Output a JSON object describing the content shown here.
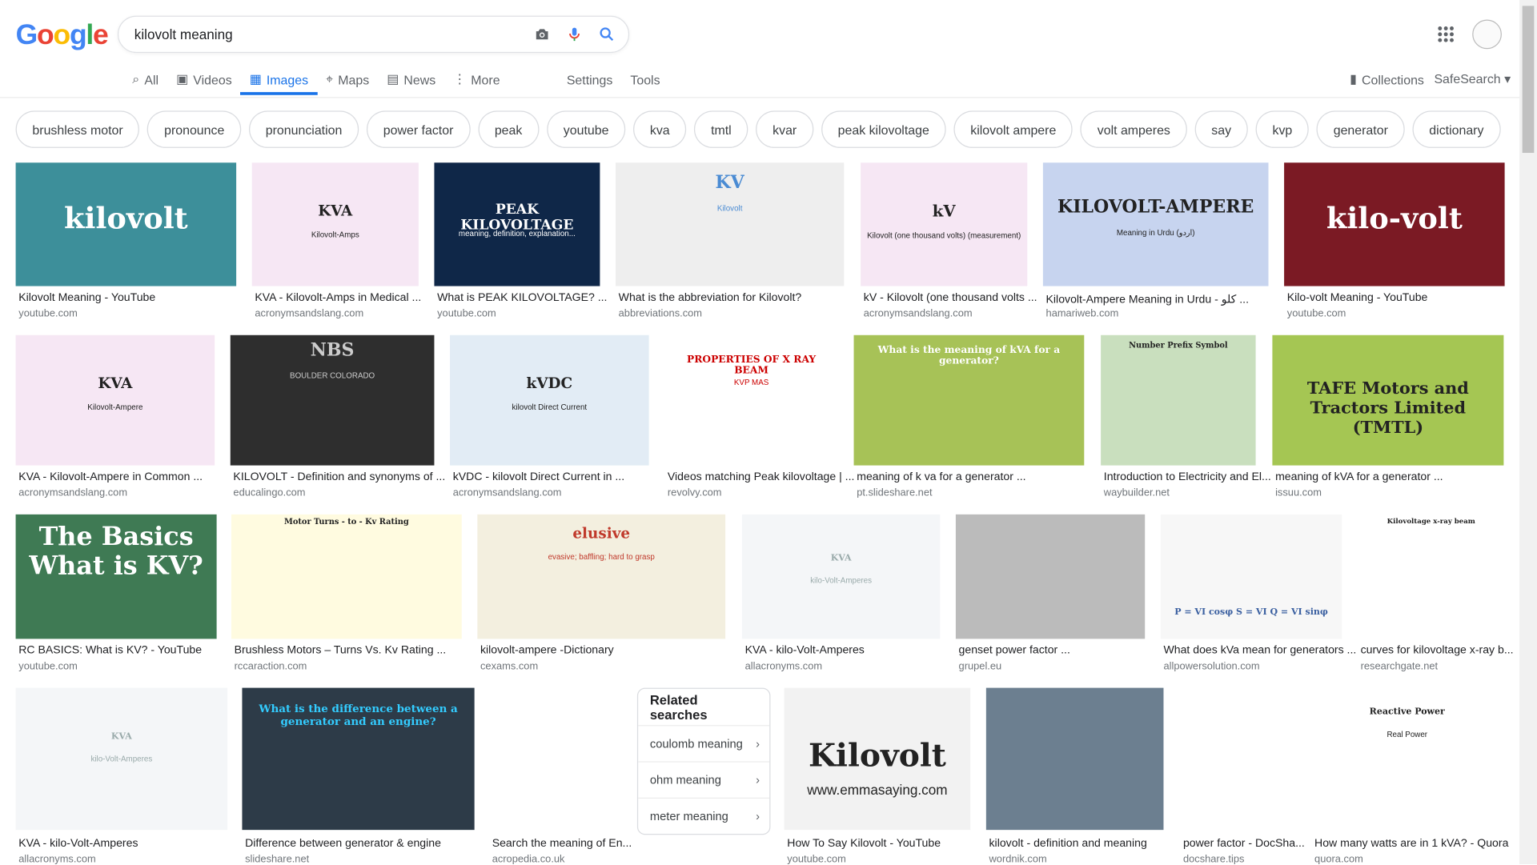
{
  "logo": "Google",
  "search": {
    "query": "kilovolt meaning"
  },
  "tabs": [
    {
      "label": "All",
      "icon": "search-icon"
    },
    {
      "label": "Videos",
      "icon": "video-icon"
    },
    {
      "label": "Images",
      "icon": "image-icon",
      "active": true
    },
    {
      "label": "Maps",
      "icon": "map-pin-icon"
    },
    {
      "label": "News",
      "icon": "news-icon"
    },
    {
      "label": "More",
      "icon": "more-icon"
    }
  ],
  "settings_label": "Settings",
  "tools_label": "Tools",
  "collections_label": "Collections",
  "safesearch_label": "SafeSearch",
  "chips": [
    "brushless motor",
    "pronounce",
    "pronunciation",
    "power factor",
    "peak",
    "youtube",
    "kva",
    "tmtl",
    "kvar",
    "peak kilovoltage",
    "kilovolt ampere",
    "volt amperes",
    "say",
    "kvp",
    "generator",
    "dictionary"
  ],
  "results": [
    {
      "title": "Kilovolt Meaning - YouTube",
      "source": "youtube.com",
      "thumb_text": "kilovolt",
      "thumb_sub": ""
    },
    {
      "title": "KVA - Kilovolt-Amps in Medical ...",
      "source": "acronymsandslang.com",
      "thumb_text": "KVA",
      "thumb_sub": "Kilovolt-Amps"
    },
    {
      "title": "What is PEAK KILOVOLTAGE? ...",
      "source": "youtube.com",
      "thumb_text": "PEAK KILOVOLTAGE",
      "thumb_sub": "meaning, definition, explanation..."
    },
    {
      "title": "What is the abbreviation for Kilovolt?",
      "source": "abbreviations.com",
      "thumb_text": "KV",
      "thumb_sub": "Kilovolt"
    },
    {
      "title": "kV - Kilovolt (one thousand volts ...",
      "source": "acronymsandslang.com",
      "thumb_text": "kV",
      "thumb_sub": "Kilovolt (one thousand volts) (measurement)"
    },
    {
      "title": "Kilovolt-Ampere Meaning in Urdu - کلو ...",
      "source": "hamariweb.com",
      "thumb_text": "KILOVOLT-AMPERE",
      "thumb_sub": "Meaning in Urdu (اردو)"
    },
    {
      "title": "Kilo-volt Meaning - YouTube",
      "source": "youtube.com",
      "thumb_text": "kilo-volt",
      "thumb_sub": ""
    },
    {
      "title": "KVA - Kilovolt-Ampere in Common ...",
      "source": "acronymsandslang.com",
      "thumb_text": "KVA",
      "thumb_sub": "Kilovolt-Ampere"
    },
    {
      "title": "KILOVOLT - Definition and synonyms of ...",
      "source": "educalingo.com",
      "thumb_text": "NBS",
      "thumb_sub": "BOULDER COLORADO"
    },
    {
      "title": "kVDC - kilovolt Direct Current in ...",
      "source": "acronymsandslang.com",
      "thumb_text": "kVDC",
      "thumb_sub": "kilovolt Direct Current"
    },
    {
      "title": "Videos matching Peak kilovoltage | ...",
      "source": "revolvy.com",
      "thumb_text": "PROPERTIES OF X RAY BEAM",
      "thumb_sub": "KVP   MAS"
    },
    {
      "title": "meaning of k va for a generator ...",
      "source": "pt.slideshare.net",
      "thumb_text": "What is the meaning of kVA for a generator?",
      "thumb_sub": ""
    },
    {
      "title": "Introduction to Electricity and El...",
      "source": "waybuilder.net",
      "thumb_text": "Number  Prefix  Symbol",
      "thumb_sub": ""
    },
    {
      "title": "meaning of kVA for a generator ...",
      "source": "issuu.com",
      "thumb_text": "TAFE Motors and Tractors Limited (TMTL)",
      "thumb_sub": ""
    },
    {
      "title": "RC BASICS: What is KV? - YouTube",
      "source": "youtube.com",
      "thumb_text": "The Basics What is KV?",
      "thumb_sub": ""
    },
    {
      "title": "Brushless Motors – Turns Vs. Kv Rating ...",
      "source": "rccaraction.com",
      "thumb_text": "Motor Turns - to - Kv Rating",
      "thumb_sub": ""
    },
    {
      "title": "kilovolt-ampere -Dictionary",
      "source": "cexams.com",
      "thumb_text": "elusive",
      "thumb_sub": "evasive; baffling; hard to grasp"
    },
    {
      "title": "KVA - kilo-Volt-Amperes",
      "source": "allacronyms.com",
      "thumb_text": "KVA",
      "thumb_sub": "kilo-Volt-Amperes"
    },
    {
      "title": "genset power factor ...",
      "source": "grupel.eu",
      "thumb_text": "",
      "thumb_sub": ""
    },
    {
      "title": "What does kVa mean for generators ...",
      "source": "allpowersolution.com",
      "thumb_text": "P = VI cosφ   S = VI   Q = VI sinφ",
      "thumb_sub": ""
    },
    {
      "title": "curves for kilovoltage x-ray b...",
      "source": "researchgate.net",
      "thumb_text": "Kilovoltage x-ray beam",
      "thumb_sub": ""
    },
    {
      "title": "KVA - kilo-Volt-Amperes",
      "source": "allacronyms.com",
      "thumb_text": "KVA",
      "thumb_sub": "kilo-Volt-Amperes"
    },
    {
      "title": "Difference between generator & engine",
      "source": "slideshare.net",
      "thumb_text": "What is the difference between a generator and an engine?",
      "thumb_sub": ""
    },
    {
      "title": "Search the meaning of En...",
      "source": "acropedia.co.uk",
      "thumb_text": "",
      "thumb_sub": ""
    },
    {
      "title": "How To Say Kilovolt - YouTube",
      "source": "youtube.com",
      "thumb_text": "Kilovolt",
      "thumb_sub": "www.emmasaying.com"
    },
    {
      "title": "kilovolt - definition and meaning",
      "source": "wordnik.com",
      "thumb_text": "",
      "thumb_sub": ""
    },
    {
      "title": "power factor - DocSha...",
      "source": "docshare.tips",
      "thumb_text": "",
      "thumb_sub": ""
    },
    {
      "title": "How many watts are in 1 kVA? - Quora",
      "source": "quora.com",
      "thumb_text": "Reactive Power",
      "thumb_sub": "Real Power"
    }
  ],
  "related": {
    "title": "Related searches",
    "items": [
      "coulomb meaning",
      "ohm meaning",
      "meter meaning"
    ]
  }
}
